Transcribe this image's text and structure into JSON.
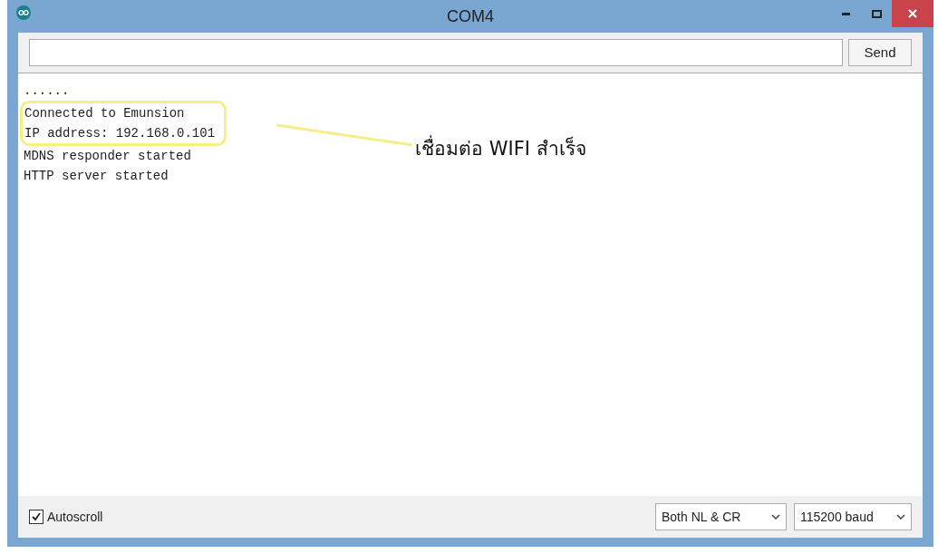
{
  "window": {
    "title": "COM4"
  },
  "send_button": "Send",
  "output_lines": [
    {
      "text": "......",
      "highlighted": false
    },
    {
      "text": "Connected to Emunsion",
      "highlighted": true
    },
    {
      "text": "IP address: 192.168.0.101",
      "highlighted": true
    },
    {
      "text": "MDNS responder started",
      "highlighted": false
    },
    {
      "text": "HTTP server started",
      "highlighted": false
    }
  ],
  "annotation": {
    "text": "เชื่อมต่อ WIFI สำเร็จ"
  },
  "autoscroll": {
    "label": "Autoscroll",
    "checked": true
  },
  "line_ending": "Both NL & CR",
  "baud_rate": "115200 baud"
}
